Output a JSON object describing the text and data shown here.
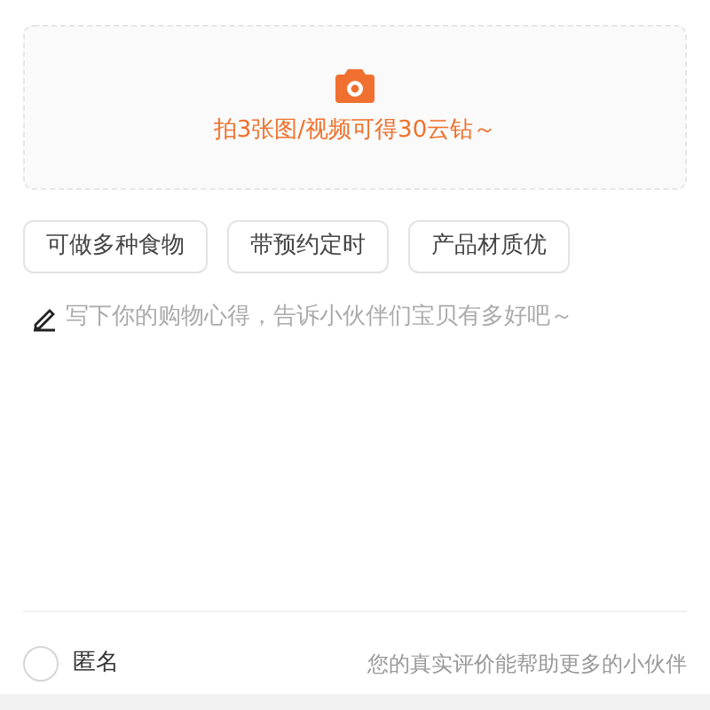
{
  "upload": {
    "hint": "拍3张图/视频可得30云钻～"
  },
  "tags": [
    {
      "label": "可做多种食物",
      "selected": false
    },
    {
      "label": "带预约定时",
      "selected": false
    },
    {
      "label": "产品材质优",
      "selected": false
    }
  ],
  "review": {
    "placeholder": "写下你的购物心得，告诉小伙伴们宝贝有多好吧～"
  },
  "anonymous": {
    "label": "匿名",
    "checked": false
  },
  "footer_note": "您的真实评价能帮助更多的小伙伴"
}
